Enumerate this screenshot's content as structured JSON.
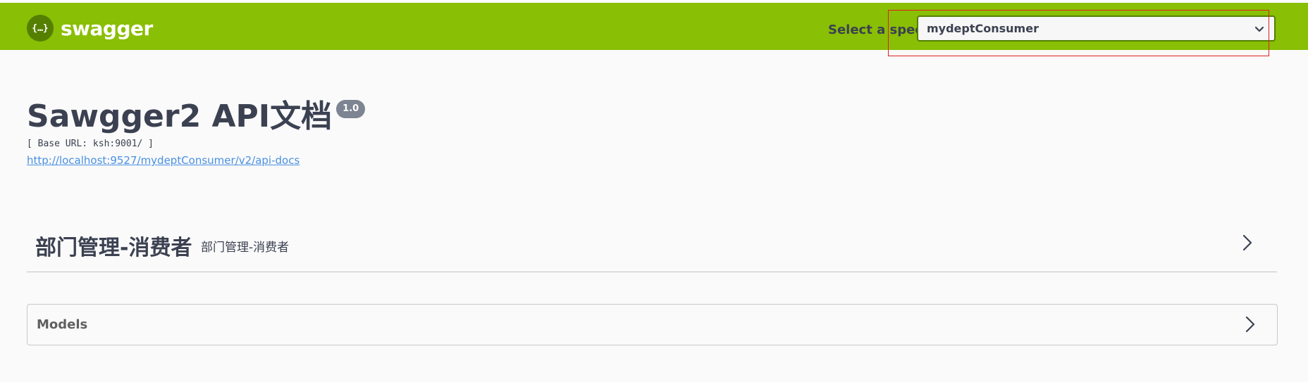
{
  "topbar": {
    "logo_icon_text": "{…}",
    "logo_text": "swagger",
    "spec_label": "Select a spec",
    "spec_selected": "mydeptConsumer",
    "color": "#89bf04",
    "icons": {
      "logo": "swagger-logo-icon",
      "chevron": "chevron-down-icon"
    }
  },
  "info": {
    "title": "Sawgger2 API文档",
    "version": "1.0",
    "base_url": "[ Base URL: ksh:9001/ ]",
    "spec_link": "http://localhost:9527/mydeptConsumer/v2/api-docs"
  },
  "tag": {
    "name": "部门管理-消费者",
    "description": "部门管理-消费者",
    "icon": "chevron-right-icon"
  },
  "models": {
    "label": "Models",
    "icon": "chevron-right-icon"
  },
  "colors": {
    "link": "#4990e2",
    "text": "#3b4151",
    "highlight": "#e02020"
  }
}
